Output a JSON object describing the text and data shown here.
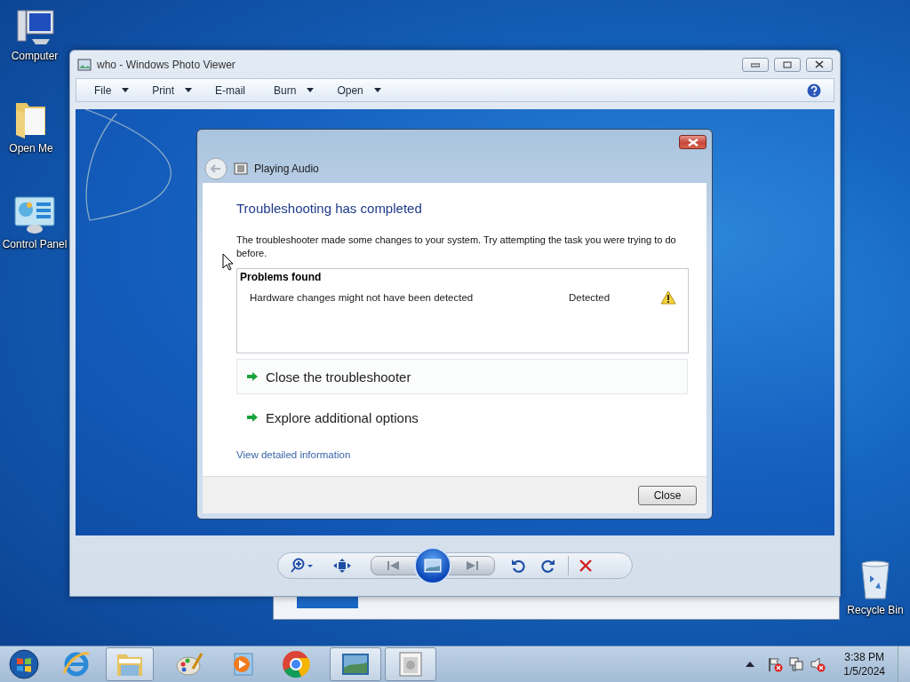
{
  "desktop_icons": [
    {
      "label": "Computer",
      "kind": "computer"
    },
    {
      "label": "Open Me",
      "kind": "folder"
    },
    {
      "label": "Control Panel",
      "kind": "control_panel"
    },
    {
      "label": "Recycle Bin",
      "kind": "recycle_bin"
    }
  ],
  "photo_viewer": {
    "title": "who - Windows Photo Viewer",
    "menu": [
      {
        "label": "File",
        "dropdown": true
      },
      {
        "label": "Print",
        "dropdown": true
      },
      {
        "label": "E-mail",
        "dropdown": false
      },
      {
        "label": "Burn",
        "dropdown": true
      },
      {
        "label": "Open",
        "dropdown": true
      }
    ],
    "image": {
      "dialog": {
        "title": "Playing Audio",
        "heading": "Troubleshooting has completed",
        "message": "The troubleshooter made some changes to your system. Try attempting the task you were trying to do before.",
        "problems": {
          "title": "Problems found",
          "rows": [
            {
              "problem": "Hardware changes might not have been detected",
              "status": "Detected",
              "kind": "warning"
            }
          ]
        },
        "options": [
          {
            "label": "Close the troubleshooter",
            "highlighted": true
          },
          {
            "label": "Explore additional options",
            "highlighted": false
          }
        ],
        "details_link": "View detailed information",
        "button": "Close"
      }
    }
  },
  "taskbar": {
    "items": [
      {
        "kind": "start",
        "active": false
      },
      {
        "kind": "browser_e",
        "active": false
      },
      {
        "kind": "folder",
        "active": true
      },
      {
        "kind": "paint",
        "active": false
      },
      {
        "kind": "media",
        "active": false
      },
      {
        "kind": "chrome",
        "active": false
      },
      {
        "kind": "photo",
        "active": true
      },
      {
        "kind": "troubleshooter",
        "active": true
      }
    ],
    "time": "3:38 PM",
    "date": "1/5/2024"
  }
}
